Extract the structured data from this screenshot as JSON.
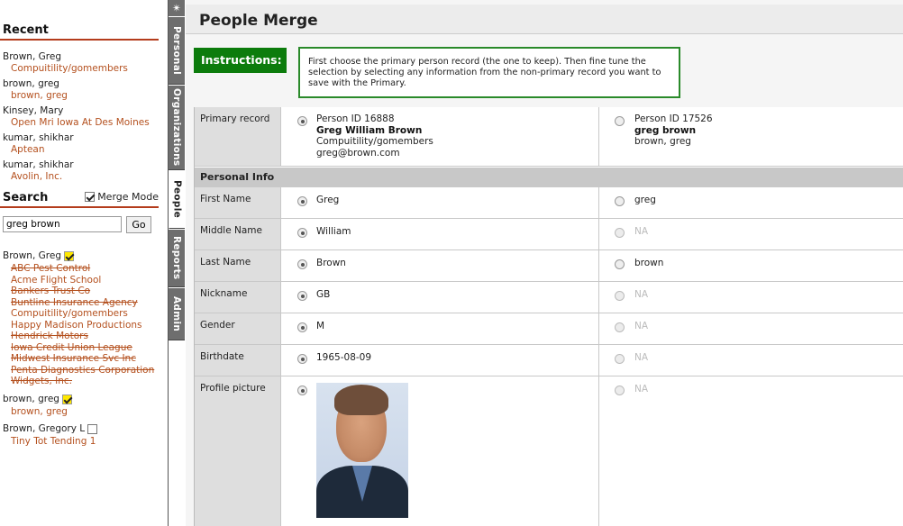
{
  "recent": {
    "title": "Recent",
    "items": [
      {
        "name": "Brown, Greg",
        "org": "Compuitility/gomembers"
      },
      {
        "name": "brown, greg",
        "org": "brown, greg"
      },
      {
        "name": "Kinsey, Mary",
        "org": "Open Mri Iowa At Des Moines"
      },
      {
        "name": "kumar, shikhar",
        "org": "Aptean"
      },
      {
        "name": "kumar, shikhar",
        "org": "Avolin, Inc."
      }
    ]
  },
  "search": {
    "title": "Search",
    "merge_mode_label": "Merge Mode",
    "query": "greg brown",
    "go_label": "Go",
    "results": [
      {
        "name": "Brown, Greg",
        "checked": true,
        "orgs": [
          {
            "label": "ABC Pest Control",
            "strike": true
          },
          {
            "label": "Acme Flight School",
            "strike": false
          },
          {
            "label": "Bankers Trust Co",
            "strike": true
          },
          {
            "label": "Buntline Insurance Agency",
            "strike": true
          },
          {
            "label": "Compuitility/gomembers",
            "strike": false
          },
          {
            "label": "Happy Madison Productions",
            "strike": false
          },
          {
            "label": "Hendrick Motors",
            "strike": true
          },
          {
            "label": "Iowa Credit Union League",
            "strike": true
          },
          {
            "label": "Midwest Insurance Svc Inc",
            "strike": true
          },
          {
            "label": "Penta Diagnostics Corporation",
            "strike": true
          },
          {
            "label": "Widgets, Inc.",
            "strike": true
          }
        ]
      },
      {
        "name": "brown, greg",
        "checked": true,
        "orgs": [
          {
            "label": "brown, greg",
            "strike": false
          }
        ]
      },
      {
        "name": "Brown, Gregory L",
        "checked": false,
        "orgs": [
          {
            "label": "Tiny Tot Tending 1",
            "strike": false
          }
        ]
      }
    ]
  },
  "tabs": [
    "Personal",
    "Organizations",
    "People",
    "Reports",
    "Admin"
  ],
  "page": {
    "title": "People Merge",
    "instructions_label": "Instructions:",
    "instructions_text": "First choose the primary person record (the one to keep). Then fine tune the selection by selecting any information from the non-primary record you want to save with the Primary."
  },
  "merge": {
    "primary_label": "Primary record",
    "primary": {
      "id": "Person ID 16888",
      "name": "Greg William Brown",
      "org": "Compuitility/gomembers",
      "email": "greg@brown.com"
    },
    "secondary": {
      "id": "Person ID 17526",
      "name": "greg brown",
      "org": "brown, greg"
    },
    "section": "Personal Info",
    "fields": [
      {
        "label": "First Name",
        "primary": "Greg",
        "secondary": "greg"
      },
      {
        "label": "Middle Name",
        "primary": "William",
        "secondary": "NA"
      },
      {
        "label": "Last Name",
        "primary": "Brown",
        "secondary": "brown"
      },
      {
        "label": "Nickname",
        "primary": "GB",
        "secondary": "NA"
      },
      {
        "label": "Gender",
        "primary": "M",
        "secondary": "NA"
      },
      {
        "label": "Birthdate",
        "primary": "1965-08-09",
        "secondary": "NA"
      }
    ],
    "picture_label": "Profile picture",
    "picture_secondary": "NA"
  }
}
